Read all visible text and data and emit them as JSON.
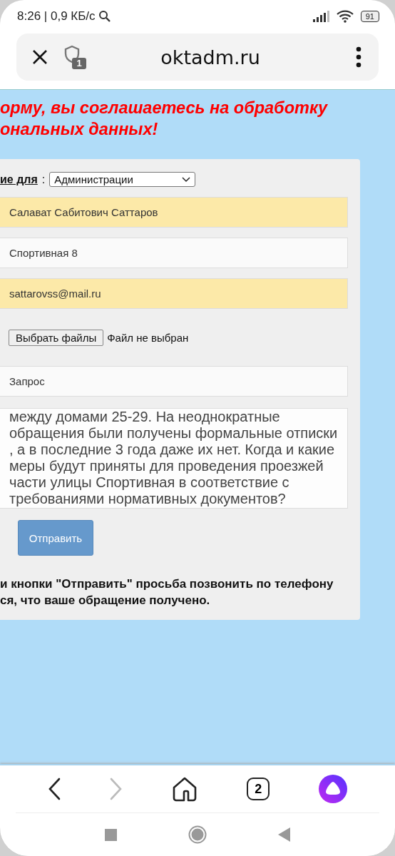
{
  "status_bar": {
    "time_speed": "8:26 | 0,9 КБ/с",
    "battery": "91"
  },
  "browser": {
    "tab_badge": "1",
    "url": "oktadm.ru"
  },
  "notice": [
    "орму, вы соглашаетесь на обработку",
    "ональных данных!"
  ],
  "form": {
    "recipient_label": "ие для",
    "separator": ":",
    "recipient": "Администрации",
    "fields": [
      {
        "value": "Салават Сабитович Саттаров",
        "autofilled": true
      },
      {
        "value": "Спортивная 8",
        "autofilled": false
      },
      {
        "value": "sattarovss@mail.ru",
        "autofilled": true
      }
    ],
    "file_button": "Выбрать файлы",
    "file_status": "Файл не выбран",
    "subject": {
      "value": "Запрос",
      "autofilled": false
    },
    "message": [
      "между домами 25-29. На неоднократные",
      "обращения были получены формальные отписки",
      ", а в последние 3 года даже их нет. Когда и какие",
      "меры будут приняты для проведения проезжей",
      "части улицы Спортивная в соответствие с",
      "требованиями нормативных документов?"
    ],
    "submit": "Отправить",
    "note": [
      "и кнопки \"Отправить\" просьба позвонить по телефону",
      "ся, что ваше обращение получено."
    ]
  },
  "bottom_bar": {
    "tabs_count": "2"
  }
}
